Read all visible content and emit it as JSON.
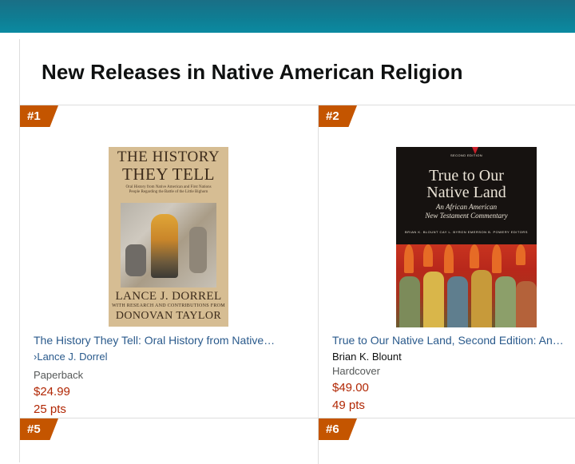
{
  "page": {
    "heading": "New Releases in Native American Religion"
  },
  "items": [
    {
      "rank": "#1",
      "title": "The History They Tell: Oral History from Native…",
      "author": "Lance J. Dorrel",
      "author_prefix": "›",
      "format": "Paperback",
      "price": "$24.99",
      "points": "25 pts",
      "cover": {
        "line1": "THE HISTORY",
        "line2": "THEY TELL",
        "subtitle": "Oral History from Native American and First Nations People Regarding the Battle of the Little Bighorn",
        "author": "LANCE J. DORREL",
        "contrib": "WITH RESEARCH AND CONTRIBUTIONS FROM",
        "coauthor": "DONOVAN TAYLOR"
      }
    },
    {
      "rank": "#2",
      "title": "True to Our Native Land, Second Edition: An…",
      "author": "Brian K. Blount",
      "format": "Hardcover",
      "price": "$49.00",
      "points": "49 pts",
      "cover": {
        "edition": "SECOND EDITION",
        "line1": "True to Our",
        "line2": "Native Land",
        "sub1": "An African American",
        "sub2": "New Testament Commentary",
        "editors": "BRIAN K. BLOUNT   CAY L. BYRON   EMERSON B. POWERY   EDITORS"
      }
    },
    {
      "rank": "#5"
    },
    {
      "rank": "#6"
    }
  ],
  "colors": {
    "header_bar": "#0f7d93",
    "rank_badge": "#c45500",
    "link": "#2a5a8c",
    "price": "#b12704"
  }
}
